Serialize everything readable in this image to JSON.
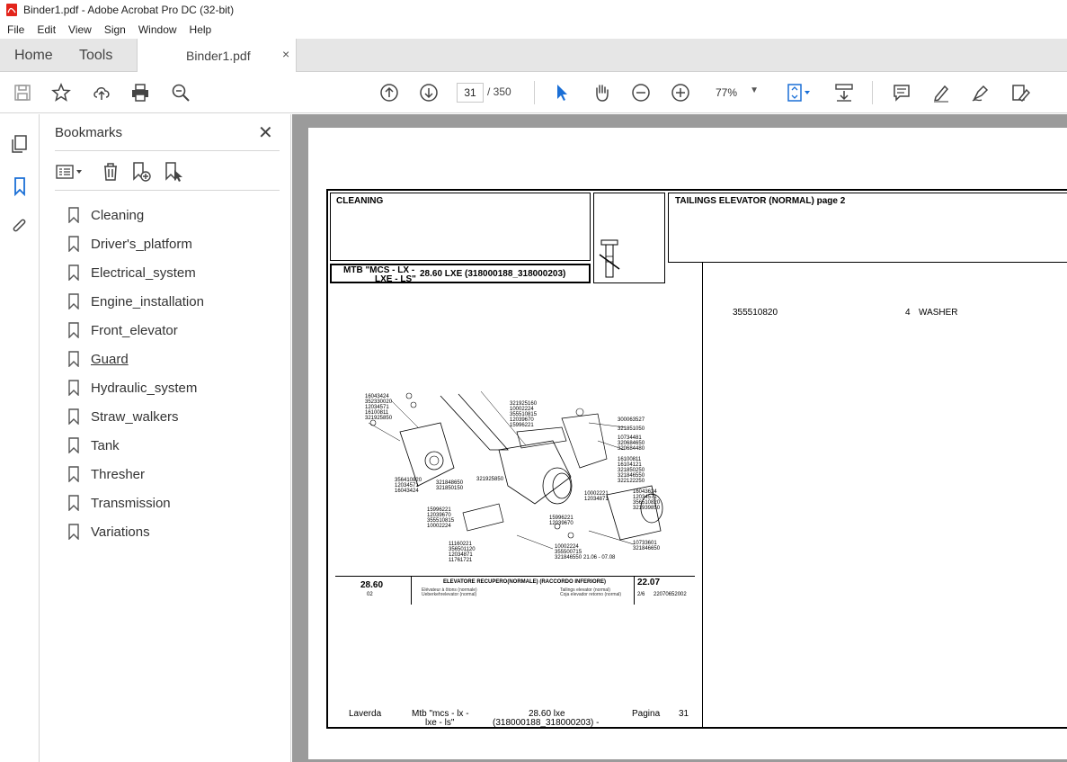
{
  "window": {
    "title": "Binder1.pdf - Adobe Acrobat Pro DC (32-bit)"
  },
  "menu": [
    "File",
    "Edit",
    "View",
    "Sign",
    "Window",
    "Help"
  ],
  "tabs": {
    "home": "Home",
    "tools": "Tools",
    "document": "Binder1.pdf",
    "close": "×"
  },
  "toolbar": {
    "current_page": "31",
    "page_total": "/  350",
    "zoom": "77%"
  },
  "bookmarks": {
    "title": "Bookmarks",
    "items": [
      "Cleaning",
      "Driver's_platform",
      "Electrical_system",
      "Engine_installation",
      "Front_elevator",
      "Guard",
      "Hydraulic_system",
      "Straw_walkers",
      "Tank",
      "Thresher",
      "Transmission",
      "Variations"
    ],
    "underlined_item": "Guard"
  },
  "document": {
    "section": "CLEANING",
    "model_line1": "MTB \"MCS - LX -",
    "model_line2": "LXE - LS\"",
    "model_code": "28.60 LXE (318000188_318000203)",
    "page_heading": "TAILINGS ELEVATOR (NORMAL)  page 2",
    "part_number": "355510820",
    "part_qty": "4",
    "part_desc": "WASHER",
    "drawing_title": "ELEVATORE RECUPERO(NORMALE) (RACCORDO INFERIORE)",
    "drawing_sub_left": "Elévateur à ôtons (normale)\nUeberkehrelevator (normal)",
    "drawing_sub_right": "Tailings elevator (normal)\nCoja elevador retorno (normal)",
    "drawing_model": "28.60",
    "drawing_model_sub": "02",
    "drawing_group": "22.07",
    "drawing_group_sub": "2/6",
    "drawing_code": "22070652002",
    "drawing_date": "21.06 - 07.08",
    "footer_brand": "Laverda",
    "footer_model_line1": "Mtb \"mcs - lx -",
    "footer_model_line2": "lxe - ls\"",
    "footer_code_line1": "28.60 lxe",
    "footer_code_line2": "(318000188_318000203)  -",
    "footer_page_label": "Pagina",
    "footer_page_num": "31",
    "callouts_left": [
      "16043424",
      "352330020",
      "12034571",
      "16100811",
      "321925850"
    ],
    "callouts_mid_top": [
      "321925160",
      "10002224",
      "355510815",
      "12039670",
      "15996221"
    ],
    "callouts_right": [
      "300063527",
      "321851050",
      "10734481",
      "320684650",
      "320684480",
      "16100811",
      "16104121",
      "321850250",
      "321846550",
      "322122250"
    ],
    "callouts_lower_left": [
      "356410820",
      "12034571",
      "16043424",
      "321848650",
      "321850150",
      "321925850"
    ],
    "callouts_lower_mid": [
      "15996221",
      "12039670",
      "355510815",
      "10002224"
    ],
    "callouts_bottom": [
      "11160221",
      "356501120",
      "12034871",
      "11761721"
    ],
    "callouts_center": [
      "10002221",
      "12034871",
      "15996221",
      "12039670",
      "10002224",
      "355500715",
      "321846550"
    ],
    "callouts_far_right": [
      "16043624",
      "12034571",
      "356510820",
      "321939850",
      "10733601",
      "321846650"
    ]
  }
}
